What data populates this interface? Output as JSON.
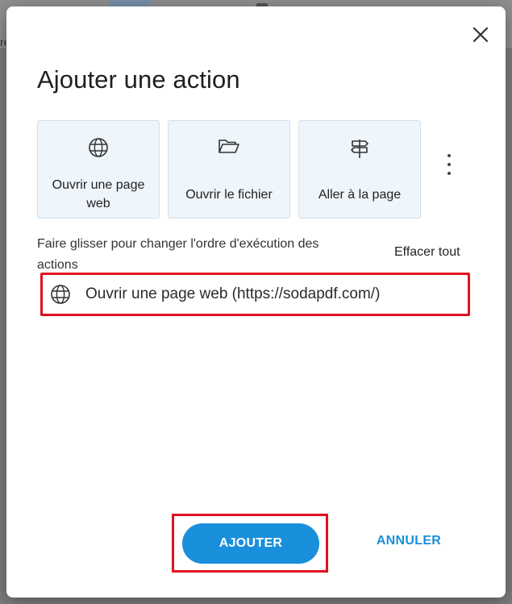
{
  "background": {
    "partial_text": "re"
  },
  "dialog": {
    "title": "Ajouter une action",
    "close_icon": "close-icon",
    "action_types": [
      {
        "label_line1": "Ouvrir une page",
        "label_line2": "web",
        "icon": "globe-icon"
      },
      {
        "label": "Ouvrir le fichier",
        "icon": "folder-open-icon"
      },
      {
        "label": "Aller à la page",
        "icon": "signpost-icon"
      }
    ],
    "more_icon": "more-vertical-icon",
    "hint_line1": "Faire glisser pour changer l'ordre d'exécution des",
    "hint_line2": "actions",
    "clear_all": "Effacer tout",
    "actions": [
      {
        "icon": "globe-icon",
        "label": "Ouvrir une page web (https://sodapdf.com/)"
      }
    ],
    "add_label": "AJOUTER",
    "cancel_label": "ANNULER"
  },
  "colors": {
    "primary": "#1a8fdb",
    "highlight_red": "#e0111f",
    "card_bg": "#eef5fb"
  }
}
